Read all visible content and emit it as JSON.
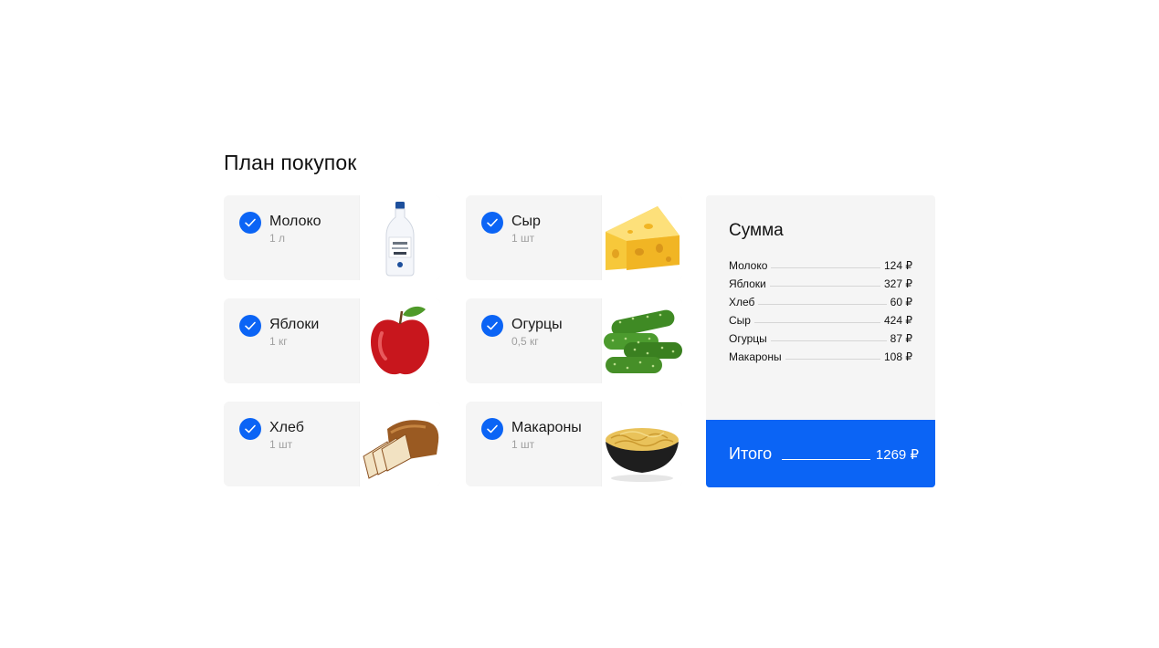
{
  "page": {
    "title": "План покупок"
  },
  "items": [
    {
      "name": "Молоко",
      "qty": "1 л",
      "icon": "milk-bottle-image",
      "checked": true
    },
    {
      "name": "Сыр",
      "qty": "1 шт",
      "icon": "cheese-image",
      "checked": true
    },
    {
      "name": "Яблоки",
      "qty": "1 кг",
      "icon": "apple-image",
      "checked": true
    },
    {
      "name": "Огурцы",
      "qty": "0,5 кг",
      "icon": "cucumbers-image",
      "checked": true
    },
    {
      "name": "Хлеб",
      "qty": "1 шт",
      "icon": "bread-image",
      "checked": true
    },
    {
      "name": "Макароны",
      "qty": "1 шт",
      "icon": "pasta-bowl-image",
      "checked": true
    }
  ],
  "summary": {
    "title": "Сумма",
    "lines": [
      {
        "name": "Молоко",
        "price": "124 ₽"
      },
      {
        "name": "Яблоки",
        "price": "327 ₽"
      },
      {
        "name": "Хлеб",
        "price": "60 ₽"
      },
      {
        "name": "Сыр",
        "price": "424 ₽"
      },
      {
        "name": "Огурцы",
        "price": "87 ₽"
      },
      {
        "name": "Макароны",
        "price": "108 ₽"
      }
    ],
    "total_label": "Итого",
    "total_value": "1269 ₽"
  },
  "colors": {
    "accent": "#0b64f5",
    "card_bg": "#f5f5f5",
    "muted_text": "#a0a0a0"
  }
}
